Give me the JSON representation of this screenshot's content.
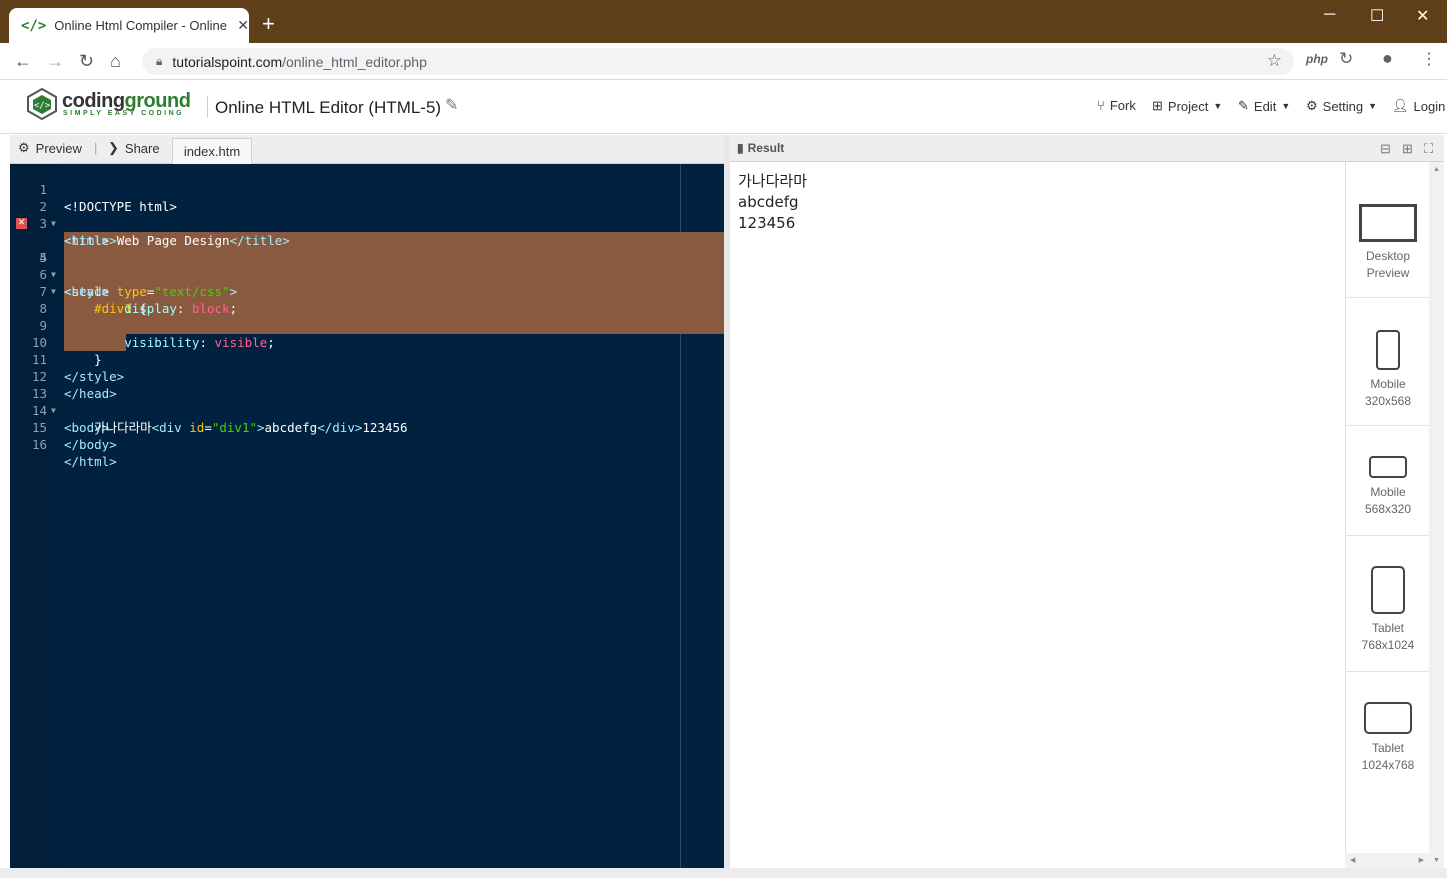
{
  "browser": {
    "tab_title": "Online Html Compiler - Online H",
    "tab_favicon": "</>",
    "new_tab": "+",
    "url_host": "tutorialspoint.com",
    "url_path": "/online_html_editor.php",
    "ext1": "php",
    "min": "─",
    "max": "☐",
    "close": "✕"
  },
  "app": {
    "brand_a": "coding",
    "brand_b": "ground",
    "tagline": "SIMPLY EASY CODING",
    "page_title": "Online HTML Editor (HTML-5)",
    "menu": {
      "fork": "Fork",
      "project": "Project",
      "edit": "Edit",
      "setting": "Setting",
      "login": "Login"
    }
  },
  "editor_tabs": {
    "preview": "Preview",
    "share": "Share",
    "file": "index.htm"
  },
  "code_lines": [
    "1",
    "2",
    "3",
    "4",
    "5",
    "6",
    "7",
    "8",
    "9",
    "10",
    "11",
    "12",
    "13",
    "14",
    "15",
    "16"
  ],
  "code": {
    "l1": "<!DOCTYPE html>",
    "l2": "<html>",
    "l3a": "<title>",
    "l3b": "Web Page Design",
    "l3c": "</title>",
    "l4": "<head>",
    "l5a": "<style ",
    "l5b": "type",
    "l5c": "=",
    "l5d": "\"text/css\"",
    "l5e": ">",
    "l6a": "    #div1",
    "l6b": " {",
    "l7a": "        display",
    "l7b": ": ",
    "l7c": "block",
    "l7d": ";",
    "l9a": "        visibility",
    "l9b": ": ",
    "l9c": "visible",
    "l9d": ";",
    "l10": "    }",
    "l11": "</style>",
    "l12": "</head>",
    "l13": "<body>",
    "l14a": "    가나다라마",
    "l14b": "<div ",
    "l14c": "id",
    "l14d": "=",
    "l14e": "\"div1\"",
    "l14f": ">",
    "l14g": "abcdefg",
    "l14h": "</div>",
    "l14i": "123456",
    "l15": "</body>",
    "l16": "</html>"
  },
  "result": {
    "label": "Result",
    "output": [
      "가나다라마",
      "abcdefg",
      "123456"
    ]
  },
  "devices": [
    {
      "name": "Desktop",
      "size": "Preview"
    },
    {
      "name": "Mobile",
      "size": "320x568"
    },
    {
      "name": "Mobile",
      "size": "568x320"
    },
    {
      "name": "Tablet",
      "size": "768x1024"
    },
    {
      "name": "Tablet",
      "size": "1024x768"
    }
  ]
}
